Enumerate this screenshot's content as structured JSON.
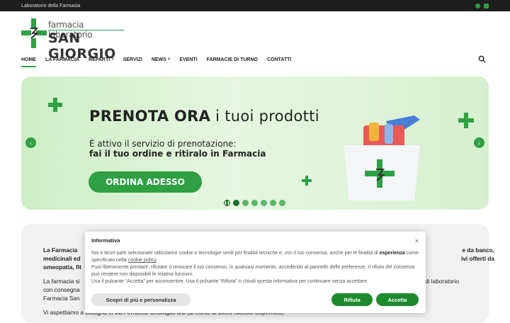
{
  "topbar": {
    "label": "Laboratorio della Farmacia",
    "icons": [
      "whatsapp-icon",
      "email-icon"
    ]
  },
  "logo": {
    "line1": "farmacia laboratorio",
    "line2": "SAN GIORGIO"
  },
  "nav": {
    "items": [
      {
        "label": "HOME",
        "active": true
      },
      {
        "label": "LA FARMACIA"
      },
      {
        "label": "REPARTI",
        "dropdown": true
      },
      {
        "label": "SERVIZI"
      },
      {
        "label": "NEWS",
        "dropdown": true
      },
      {
        "label": "EVENTI"
      },
      {
        "label": "FARMACIE DI TURNO"
      },
      {
        "label": "CONTATTI"
      }
    ],
    "chevron": "˅"
  },
  "hero": {
    "title_bold": "PRENOTA ORA",
    "title_rest": " i tuoi prodotti",
    "line1": "È attivo il servizio di prenotazione:",
    "line2": "fai il tuo ordine e ritiralo in Farmacia",
    "cta": "ORDINA ADESSO",
    "prev": "‹",
    "next": "›",
    "slides_total": 7,
    "active_slide": 1,
    "accent": "#2ea043"
  },
  "content": {
    "p1": "La Farmacia",
    "p1_right_a": "e da banco,",
    "p1_line2": "medicinali ed",
    "p1_right_b": "ivi offerti da",
    "p1_line3": "omeopatia, fit",
    "p2": "La farmacia si",
    "p2_right": "di laboratorio",
    "p2_line2": "con consegna",
    "p2_line3": "Farmacia San",
    "p3": "Vi aspettiamo a Bologna in via Ferruccio Gravaglia 6/B (di fronte al Liceo Niccolò Copernico)."
  },
  "cookie": {
    "title": "Informativa",
    "close": "×",
    "text1_a": "Noi e terze parti selezionate utilizziamo cookie o tecnologie simili per finalità tecniche e, con il tuo consenso, anche per le finalità di ",
    "text1_b": "esperienza",
    "text1_c": " come specificato nella ",
    "text1_link": "cookie policy",
    "text1_d": ".",
    "text2": "Puoi liberamente prestare, rifiutare o revocare il tuo consenso, in qualsiasi momento, accedendo al pannello delle preferenze. Il rifiuto del consenso può rendere non disponibili le relative funzioni.",
    "text3": "Usa il pulsante “Accetta” per acconsentire. Usa il pulsante “Rifiuta” o chiudi questa informativa per continuare senza accettare.",
    "learn_more": "Scopri di più e personalizza",
    "reject": "Rifiuta",
    "accept": "Accetta",
    "button_color": "#1e8a2e"
  }
}
